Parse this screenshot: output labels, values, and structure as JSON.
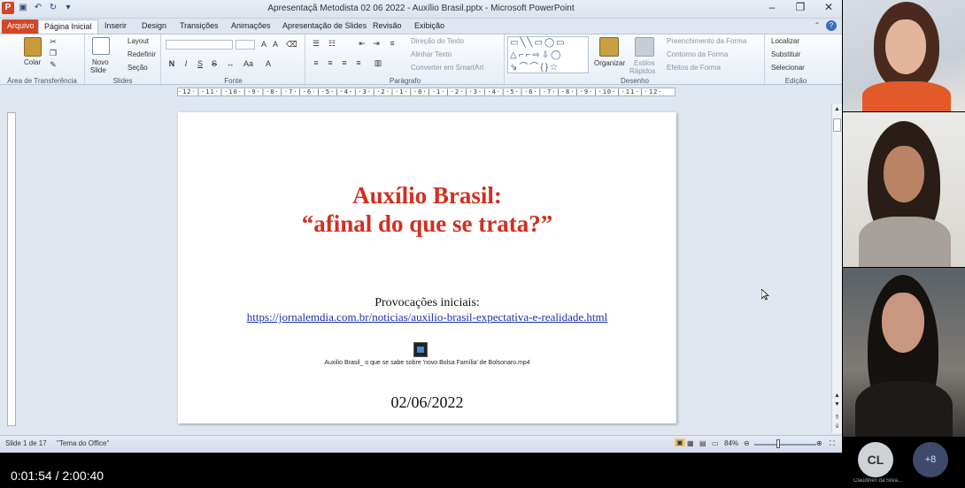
{
  "window": {
    "title": "Apresentaçã Metodista 02 06 2022 - Auxílio Brasil.pptx - Microsoft PowerPoint",
    "minimize": "–",
    "restore": "❐",
    "close": "✕"
  },
  "tabs": [
    "Arquivo",
    "Página Inicial",
    "Inserir",
    "Design",
    "Transições",
    "Animações",
    "Apresentação de Slides",
    "Revisão",
    "Exibição"
  ],
  "ribbon": {
    "clipboard": {
      "paste": "Colar",
      "label": "Área de Transferência"
    },
    "slides": {
      "new_slide": "Novo",
      "new_slide2": "Slide",
      "layout": "Layout",
      "reset": "Redefinir",
      "section": "Seção",
      "label": "Slides"
    },
    "font": {
      "label": "Fonte"
    },
    "paragraph": {
      "text_direction": "Direção do Texto",
      "align_text": "Alinhar Texto",
      "smartart": "Converter em SmartArt",
      "label": "Parágrafo"
    },
    "drawing": {
      "arrange": "Organizar",
      "quick_styles": "Estilos",
      "quick_styles2": "Rápidos",
      "fill": "Preenchimento da Forma",
      "outline": "Contorno da Forma",
      "effects": "Efeitos de Forma",
      "label": "Desenho"
    },
    "editing": {
      "find": "Localizar",
      "replace": "Substituir",
      "select": "Selecionar",
      "label": "Edição"
    }
  },
  "ruler": "·12·|·11·|·10·|·9·|·8·|·7·|·6·|·5·|·4·|·3·|·2·|·1·|·0·|·1·|·2·|·3·|·4·|·5·|·6·|·7·|·8·|·9·|·10·|·11·|·12·",
  "slide": {
    "title_line1": "Auxílio Brasil:",
    "title_line2": "“afinal do que se trata?”",
    "provocations": "Provocações iniciais:",
    "link": "https://jornalemdia.com.br/noticias/auxilio-brasil-expectativa-e-realidade.html",
    "media_label": "Auxilio Brasil_ o que se sabe sobre 'novo Bolsa Família' de Bolsonaro.mp4",
    "date": "02/06/2022",
    "title_color": "#d22f21"
  },
  "status": {
    "slide_info": "Slide 1 de 17",
    "theme": "\"Tema do Office\"",
    "zoom": "84%"
  },
  "player": {
    "time": "0:01:54  /  2:00:40"
  },
  "participants": {
    "avatar_initials": "CL",
    "avatar_name": "Claudineri da Silva...",
    "more": "+8"
  }
}
